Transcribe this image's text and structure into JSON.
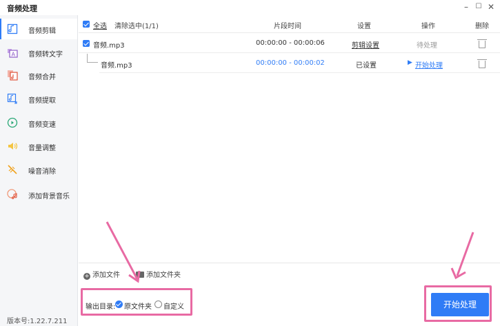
{
  "window": {
    "title": "音频处理",
    "minimize": "–",
    "maximize": "☐",
    "close": "✕"
  },
  "sidebar": {
    "items": [
      {
        "label": "音频剪辑",
        "icon": "audio-cut-icon",
        "active": true
      },
      {
        "label": "音频转文字",
        "icon": "audio-to-text-icon",
        "active": false
      },
      {
        "label": "音频合并",
        "icon": "audio-merge-icon",
        "active": false
      },
      {
        "label": "音频提取",
        "icon": "audio-extract-icon",
        "active": false
      },
      {
        "label": "音频变速",
        "icon": "audio-speed-icon",
        "active": false
      },
      {
        "label": "音量调整",
        "icon": "volume-icon",
        "active": false
      },
      {
        "label": "噪音消除",
        "icon": "noise-reduction-icon",
        "active": false
      },
      {
        "label": "添加背景音乐",
        "icon": "bgm-icon",
        "active": false
      }
    ],
    "version": "版本号:1.22.7.211"
  },
  "table": {
    "select_all": "全选",
    "clear_selection": "清除选中(1/1)",
    "headers": {
      "segment_time": "片段时间",
      "settings": "设置",
      "operation": "操作",
      "delete": "删除"
    },
    "rows": [
      {
        "name": "音频.mp3",
        "time": "00:00:00 - 00:00:06",
        "setting": "剪辑设置",
        "operation": "待处理"
      },
      {
        "name": "音频.mp3",
        "time": "00:00:00 - 00:00:02",
        "setting": "已设置",
        "operation": "开始处理"
      }
    ]
  },
  "toolbar": {
    "add_file": "添加文件",
    "add_folder": "添加文件夹"
  },
  "output": {
    "label": "输出目录:",
    "option_original": "原文件夹",
    "option_custom": "自定义",
    "selected": "原文件夹"
  },
  "start_button": "开始处理",
  "colors": {
    "accent": "#2f7cf6",
    "highlight": "#e86aa3",
    "sidebar_bg": "#f5f6f8"
  }
}
